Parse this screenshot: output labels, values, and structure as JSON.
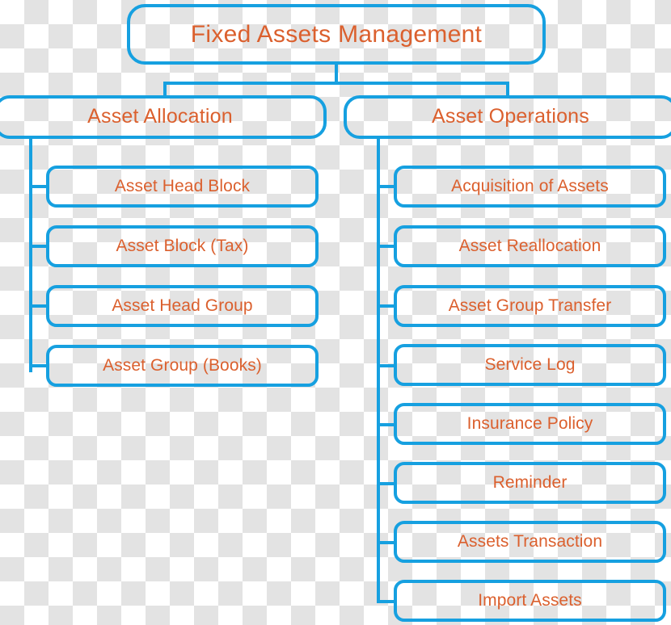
{
  "diagram": {
    "type": "organizational-tree",
    "title": "Fixed Assets Management",
    "colors": {
      "border": "#16A0E0",
      "text": "#DB602E",
      "background_light": "#ffffff",
      "background_checker": "#e3e3e3"
    },
    "root": {
      "label": "Fixed Assets Management"
    },
    "branches": [
      {
        "label": "Asset Allocation",
        "children": [
          {
            "label": "Asset Head Block"
          },
          {
            "label": "Asset Block (Tax)"
          },
          {
            "label": "Asset Head Group"
          },
          {
            "label": "Asset Group (Books)"
          }
        ]
      },
      {
        "label": "Asset Operations",
        "children": [
          {
            "label": "Acquisition of Assets"
          },
          {
            "label": "Asset Reallocation"
          },
          {
            "label": "Asset Group Transfer"
          },
          {
            "label": "Service Log"
          },
          {
            "label": "Insurance Policy"
          },
          {
            "label": "Reminder"
          },
          {
            "label": "Assets Transaction"
          },
          {
            "label": "Import Assets"
          }
        ]
      }
    ]
  }
}
